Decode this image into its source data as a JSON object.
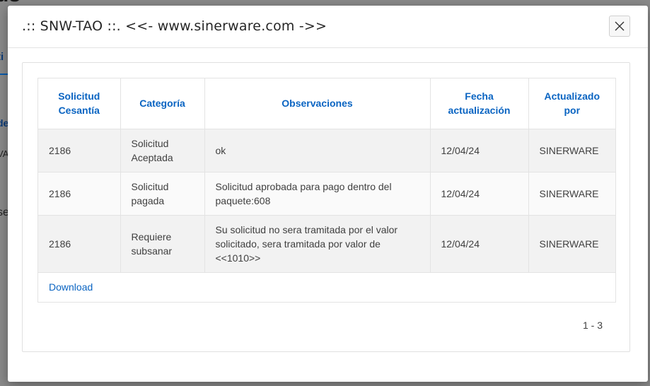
{
  "background": {
    "title_fragment": "us",
    "frag1": "ti",
    "frag2": "de",
    "frag3": "VA",
    "frag4": "se"
  },
  "dialog": {
    "title": ".:: SNW-TAO ::.  <<- www.sinerware.com ->>",
    "close_icon": "close-icon"
  },
  "table": {
    "headers": {
      "solicitud": "Solicitud Cesantía",
      "categoria": "Categoría",
      "observaciones": "Observaciones",
      "fecha": "Fecha actualización",
      "actualizado": "Actualizado por"
    },
    "rows": [
      {
        "solicitud": "2186",
        "categoria": "Solicitud Aceptada",
        "observaciones": "ok",
        "fecha": "12/04/24",
        "actualizado": "SINERWARE"
      },
      {
        "solicitud": "2186",
        "categoria": "Solicitud pagada",
        "observaciones": "Solicitud aprobada para pago dentro del paquete:608",
        "fecha": "12/04/24",
        "actualizado": "SINERWARE"
      },
      {
        "solicitud": "2186",
        "categoria": "Requiere subsanar",
        "observaciones": "Su solicitud no sera tramitada por el valor solicitado, sera tramitada por valor de <<1010>>",
        "fecha": "12/04/24",
        "actualizado": "SINERWARE"
      }
    ],
    "download_label": "Download",
    "pagination": "1 - 3"
  },
  "colors": {
    "link": "#0a64c2",
    "row_alt": "#f2f2f2",
    "backdrop": "#7f7f7f"
  }
}
